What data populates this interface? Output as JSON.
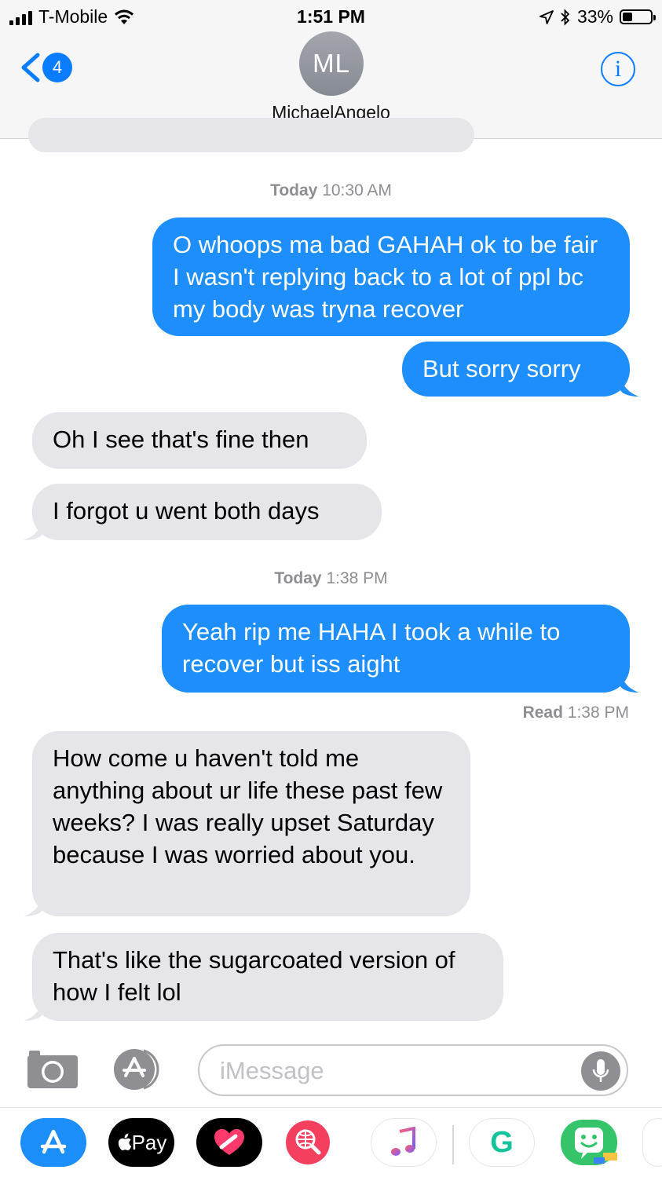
{
  "status_bar": {
    "carrier": "T-Mobile",
    "time": "1:51 PM",
    "battery": "33%",
    "battery_level": 0.33
  },
  "nav": {
    "back_badge": "4",
    "avatar_initials": "ML",
    "contact_name": "MichaelAngelo",
    "info_label": "i"
  },
  "messages": [
    {
      "type": "timestamp",
      "day": "Today",
      "time": "10:30 AM"
    },
    {
      "type": "sent",
      "text": "O whoops ma bad GAHAH ok to be fair I wasn't replying back to a lot of ppl bc my body was tryna recover"
    },
    {
      "type": "sent",
      "text": "But sorry sorry"
    },
    {
      "type": "received",
      "text": "Oh I see that's fine then"
    },
    {
      "type": "received",
      "text": "I forgot u went both days"
    },
    {
      "type": "timestamp",
      "day": "Today",
      "time": "1:38 PM"
    },
    {
      "type": "sent",
      "text": "Yeah rip me HAHA I took a while to recover but iss aight"
    },
    {
      "type": "read_receipt",
      "label": "Read",
      "time": "1:38 PM"
    },
    {
      "type": "received",
      "text": "How come u haven't told me anything about ur life these past few weeks? I was really upset Saturday because I was worried about you."
    },
    {
      "type": "received",
      "text": "That's like the sugarcoated version of how I felt lol"
    }
  ],
  "compose": {
    "placeholder": "iMessage"
  },
  "app_drawer": {
    "apps": [
      {
        "name": "App Store",
        "icon": "app-store-icon",
        "color": "#1c8ef9"
      },
      {
        "name": "Apple Pay",
        "label": "Pay",
        "icon": "apple-pay-icon",
        "color": "#000000"
      },
      {
        "name": "Digital Touch",
        "icon": "digital-touch-icon",
        "color": "#000000"
      },
      {
        "name": "Images",
        "icon": "globe-search-icon",
        "color": "#f43f5e"
      },
      {
        "name": "Music",
        "icon": "music-note-icon",
        "color": "#ffffff"
      },
      {
        "name": "Grammarly",
        "label": "G",
        "icon": "grammarly-icon",
        "color": "#ffffff"
      },
      {
        "name": "Bitmoji",
        "icon": "bitmoji-icon",
        "color": "#35c46a"
      }
    ]
  },
  "colors": {
    "sent_bubble": "#1d8efb",
    "received_bubble": "#e5e5ea",
    "ios_blue": "#0a7cff"
  }
}
